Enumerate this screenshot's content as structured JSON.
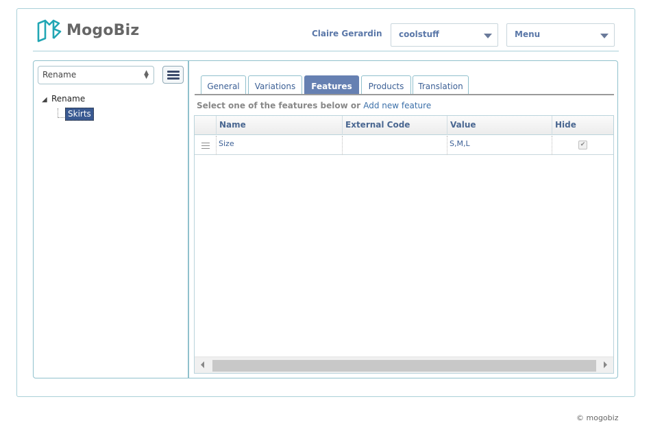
{
  "app": {
    "logo_text": "MogoBiz"
  },
  "header": {
    "user_name": "Claire Gerardin",
    "store_select": "coolstuff",
    "menu_select": "Menu"
  },
  "sidebar": {
    "catalog_select": "Rename",
    "menu_button_icon": "hamburger-icon",
    "tree": {
      "root": "Rename",
      "children": [
        "Skirts"
      ]
    }
  },
  "tabs": [
    {
      "label": "General",
      "active": false
    },
    {
      "label": "Variations",
      "active": false
    },
    {
      "label": "Features",
      "active": true
    },
    {
      "label": "Products",
      "active": false
    },
    {
      "label": "Translation",
      "active": false
    }
  ],
  "features": {
    "prompt": "Select one of the features below or",
    "add_link": "Add new feature",
    "columns": [
      "Name",
      "External Code",
      "Value",
      "Hide"
    ],
    "rows": [
      {
        "name": "Size",
        "external_code": "",
        "value": "S,M,L",
        "hide": true
      }
    ]
  },
  "footer": {
    "copyright": "© mogobiz"
  },
  "colors": {
    "accent": "#6680b2",
    "border": "#8fc0cc",
    "link": "#3b6fa8",
    "logo": "#21a6b4"
  }
}
